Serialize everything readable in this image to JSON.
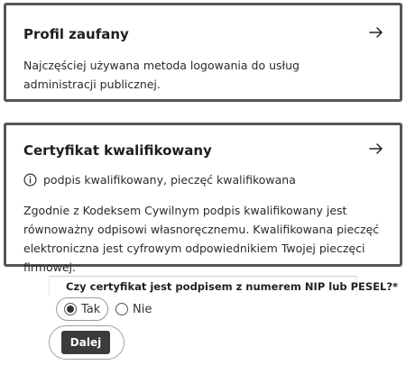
{
  "cards": [
    {
      "title": "Profil zaufany",
      "description": "Najczęściej używana metoda logowania do usług administracji publicznej.",
      "arrow_icon": "arrow-right-icon"
    },
    {
      "title": "Certyfikat kwalifikowany",
      "info_text": "podpis kwalifikowany, pieczęć kwalifikowana",
      "info_icon": "info-icon",
      "description": "Zgodnie z Kodeksem Cywilnym podpis kwalifikowany jest równoważny odpisowi własnoręcznemu. Kwalifikowana pieczęć elektroniczna jest cyfrowym odpowiednikiem Twojej pieczęci firmowej.",
      "arrow_icon": "arrow-right-icon"
    }
  ],
  "question": {
    "label": "Czy certyfikat jest podpisem z numerem NIP lub PESEL?*",
    "options": [
      {
        "label": "Tak",
        "selected": true
      },
      {
        "label": "Nie",
        "selected": false
      }
    ]
  },
  "submit": {
    "label": "Dalej"
  },
  "colors": {
    "border": "#555555",
    "button": "#3b3b3b"
  }
}
